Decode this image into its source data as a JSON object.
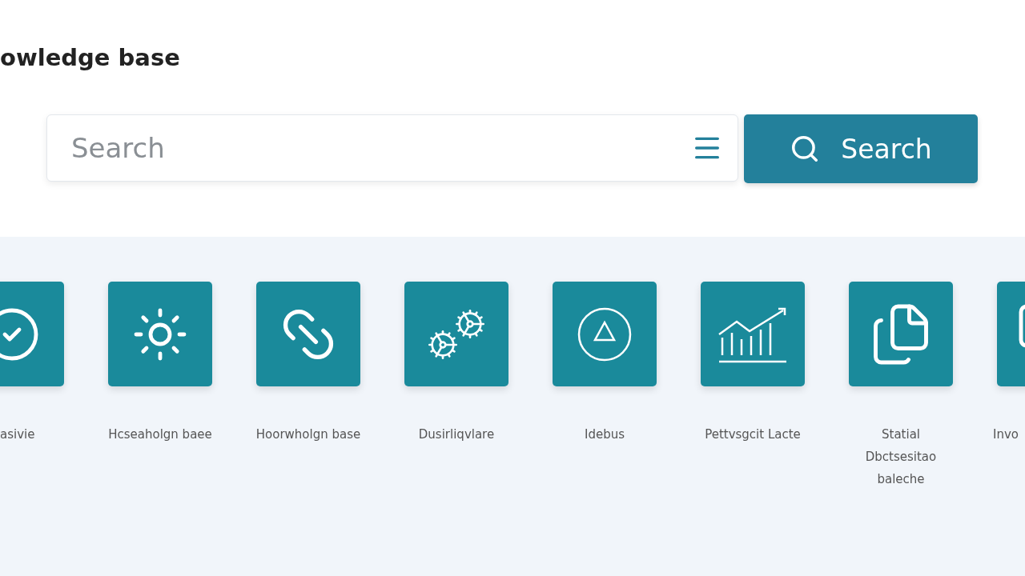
{
  "page_title": "owledge base",
  "search": {
    "placeholder": "Search",
    "button": "Search"
  },
  "categories": [
    {
      "label": "asivie"
    },
    {
      "label": "Hcseaholgn baee"
    },
    {
      "label": "Hoorwholgn base"
    },
    {
      "label": "Dusirliqvlare"
    },
    {
      "label": "Idebus"
    },
    {
      "label": "Pettvsgcit Lacte"
    },
    {
      "label": "Statial Dbctsesitao baleche"
    },
    {
      "label": "Invo"
    }
  ]
}
